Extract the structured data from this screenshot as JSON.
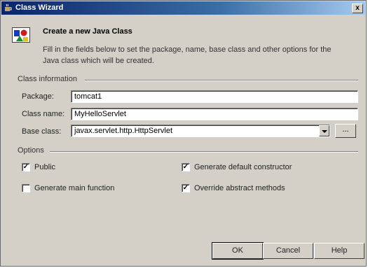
{
  "window": {
    "title": "Class Wizard",
    "close_label": "x"
  },
  "header": {
    "title": "Create a new Java Class",
    "description": "Fill in the fields below to set the package, name, base class and other options for the Java class which will be created."
  },
  "class_information": {
    "section_label": "Class information",
    "package": {
      "label": "Package:",
      "value": "tomcat1"
    },
    "class_name": {
      "label": "Class name:",
      "value": "MyHelloServlet"
    },
    "base_class": {
      "label": "Base class:",
      "value": "javax.servlet.http.HttpServlet",
      "browse_label": "..."
    }
  },
  "options": {
    "section_label": "Options",
    "public": {
      "label": "Public",
      "checked": true
    },
    "generate_main": {
      "label": "Generate main function",
      "checked": false
    },
    "generate_constructor": {
      "label": "Generate default constructor",
      "checked": true
    },
    "override_abstract": {
      "label": "Override abstract methods",
      "checked": true
    }
  },
  "buttons": {
    "ok": "OK",
    "cancel": "Cancel",
    "help": "Help"
  },
  "icons": {
    "window": "java-cup-icon",
    "header": "class-shapes-icon"
  }
}
